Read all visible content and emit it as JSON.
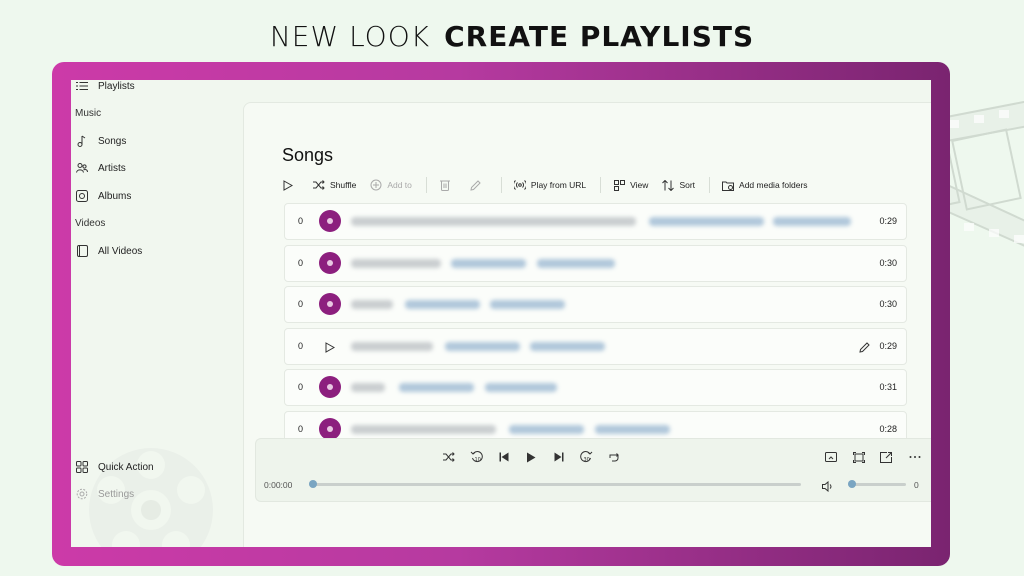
{
  "headline": {
    "light": "NEW LOOK",
    "bold": "CREATE PLAYLISTS"
  },
  "sidebar": {
    "playlists": "Playlists",
    "music_label": "Music",
    "songs": "Songs",
    "artists": "Artists",
    "albums": "Albums",
    "videos_label": "Videos",
    "all_videos": "All Videos",
    "quick_action": "Quick Action",
    "settings": "Settings"
  },
  "page": {
    "title": "Songs"
  },
  "toolbar": {
    "shuffle": "Shuffle",
    "add_to": "Add to",
    "play_from_url": "Play from URL",
    "view": "View",
    "sort": "Sort",
    "add_media_folders": "Add media folders"
  },
  "songs": [
    {
      "num": "0",
      "duration": "0:29"
    },
    {
      "num": "0",
      "duration": "0:30"
    },
    {
      "num": "0",
      "duration": "0:30"
    },
    {
      "num": "0",
      "duration": "0:29"
    },
    {
      "num": "0",
      "duration": "0:31"
    },
    {
      "num": "0",
      "duration": "0:28"
    }
  ],
  "player": {
    "elapsed": "0:00:00",
    "volume": "0",
    "seek_progress": 0,
    "volume_level": 0
  },
  "colors": {
    "accent_purple": "#8c1f7e",
    "frame_start": "#cc3aa8",
    "frame_end": "#7a2470",
    "knob": "#7aa5c2"
  }
}
